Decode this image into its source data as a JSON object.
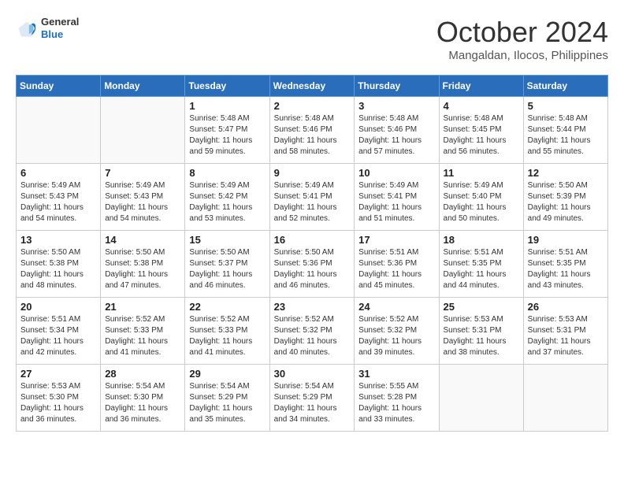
{
  "header": {
    "logo": {
      "general": "General",
      "blue": "Blue"
    },
    "title": "October 2024",
    "location": "Mangaldan, Ilocos, Philippines"
  },
  "days_of_week": [
    "Sunday",
    "Monday",
    "Tuesday",
    "Wednesday",
    "Thursday",
    "Friday",
    "Saturday"
  ],
  "weeks": [
    [
      {
        "day": "",
        "detail": ""
      },
      {
        "day": "",
        "detail": ""
      },
      {
        "day": "1",
        "detail": "Sunrise: 5:48 AM\nSunset: 5:47 PM\nDaylight: 11 hours and 59 minutes."
      },
      {
        "day": "2",
        "detail": "Sunrise: 5:48 AM\nSunset: 5:46 PM\nDaylight: 11 hours and 58 minutes."
      },
      {
        "day": "3",
        "detail": "Sunrise: 5:48 AM\nSunset: 5:46 PM\nDaylight: 11 hours and 57 minutes."
      },
      {
        "day": "4",
        "detail": "Sunrise: 5:48 AM\nSunset: 5:45 PM\nDaylight: 11 hours and 56 minutes."
      },
      {
        "day": "5",
        "detail": "Sunrise: 5:48 AM\nSunset: 5:44 PM\nDaylight: 11 hours and 55 minutes."
      }
    ],
    [
      {
        "day": "6",
        "detail": "Sunrise: 5:49 AM\nSunset: 5:43 PM\nDaylight: 11 hours and 54 minutes."
      },
      {
        "day": "7",
        "detail": "Sunrise: 5:49 AM\nSunset: 5:43 PM\nDaylight: 11 hours and 54 minutes."
      },
      {
        "day": "8",
        "detail": "Sunrise: 5:49 AM\nSunset: 5:42 PM\nDaylight: 11 hours and 53 minutes."
      },
      {
        "day": "9",
        "detail": "Sunrise: 5:49 AM\nSunset: 5:41 PM\nDaylight: 11 hours and 52 minutes."
      },
      {
        "day": "10",
        "detail": "Sunrise: 5:49 AM\nSunset: 5:41 PM\nDaylight: 11 hours and 51 minutes."
      },
      {
        "day": "11",
        "detail": "Sunrise: 5:49 AM\nSunset: 5:40 PM\nDaylight: 11 hours and 50 minutes."
      },
      {
        "day": "12",
        "detail": "Sunrise: 5:50 AM\nSunset: 5:39 PM\nDaylight: 11 hours and 49 minutes."
      }
    ],
    [
      {
        "day": "13",
        "detail": "Sunrise: 5:50 AM\nSunset: 5:38 PM\nDaylight: 11 hours and 48 minutes."
      },
      {
        "day": "14",
        "detail": "Sunrise: 5:50 AM\nSunset: 5:38 PM\nDaylight: 11 hours and 47 minutes."
      },
      {
        "day": "15",
        "detail": "Sunrise: 5:50 AM\nSunset: 5:37 PM\nDaylight: 11 hours and 46 minutes."
      },
      {
        "day": "16",
        "detail": "Sunrise: 5:50 AM\nSunset: 5:36 PM\nDaylight: 11 hours and 46 minutes."
      },
      {
        "day": "17",
        "detail": "Sunrise: 5:51 AM\nSunset: 5:36 PM\nDaylight: 11 hours and 45 minutes."
      },
      {
        "day": "18",
        "detail": "Sunrise: 5:51 AM\nSunset: 5:35 PM\nDaylight: 11 hours and 44 minutes."
      },
      {
        "day": "19",
        "detail": "Sunrise: 5:51 AM\nSunset: 5:35 PM\nDaylight: 11 hours and 43 minutes."
      }
    ],
    [
      {
        "day": "20",
        "detail": "Sunrise: 5:51 AM\nSunset: 5:34 PM\nDaylight: 11 hours and 42 minutes."
      },
      {
        "day": "21",
        "detail": "Sunrise: 5:52 AM\nSunset: 5:33 PM\nDaylight: 11 hours and 41 minutes."
      },
      {
        "day": "22",
        "detail": "Sunrise: 5:52 AM\nSunset: 5:33 PM\nDaylight: 11 hours and 41 minutes."
      },
      {
        "day": "23",
        "detail": "Sunrise: 5:52 AM\nSunset: 5:32 PM\nDaylight: 11 hours and 40 minutes."
      },
      {
        "day": "24",
        "detail": "Sunrise: 5:52 AM\nSunset: 5:32 PM\nDaylight: 11 hours and 39 minutes."
      },
      {
        "day": "25",
        "detail": "Sunrise: 5:53 AM\nSunset: 5:31 PM\nDaylight: 11 hours and 38 minutes."
      },
      {
        "day": "26",
        "detail": "Sunrise: 5:53 AM\nSunset: 5:31 PM\nDaylight: 11 hours and 37 minutes."
      }
    ],
    [
      {
        "day": "27",
        "detail": "Sunrise: 5:53 AM\nSunset: 5:30 PM\nDaylight: 11 hours and 36 minutes."
      },
      {
        "day": "28",
        "detail": "Sunrise: 5:54 AM\nSunset: 5:30 PM\nDaylight: 11 hours and 36 minutes."
      },
      {
        "day": "29",
        "detail": "Sunrise: 5:54 AM\nSunset: 5:29 PM\nDaylight: 11 hours and 35 minutes."
      },
      {
        "day": "30",
        "detail": "Sunrise: 5:54 AM\nSunset: 5:29 PM\nDaylight: 11 hours and 34 minutes."
      },
      {
        "day": "31",
        "detail": "Sunrise: 5:55 AM\nSunset: 5:28 PM\nDaylight: 11 hours and 33 minutes."
      },
      {
        "day": "",
        "detail": ""
      },
      {
        "day": "",
        "detail": ""
      }
    ]
  ]
}
